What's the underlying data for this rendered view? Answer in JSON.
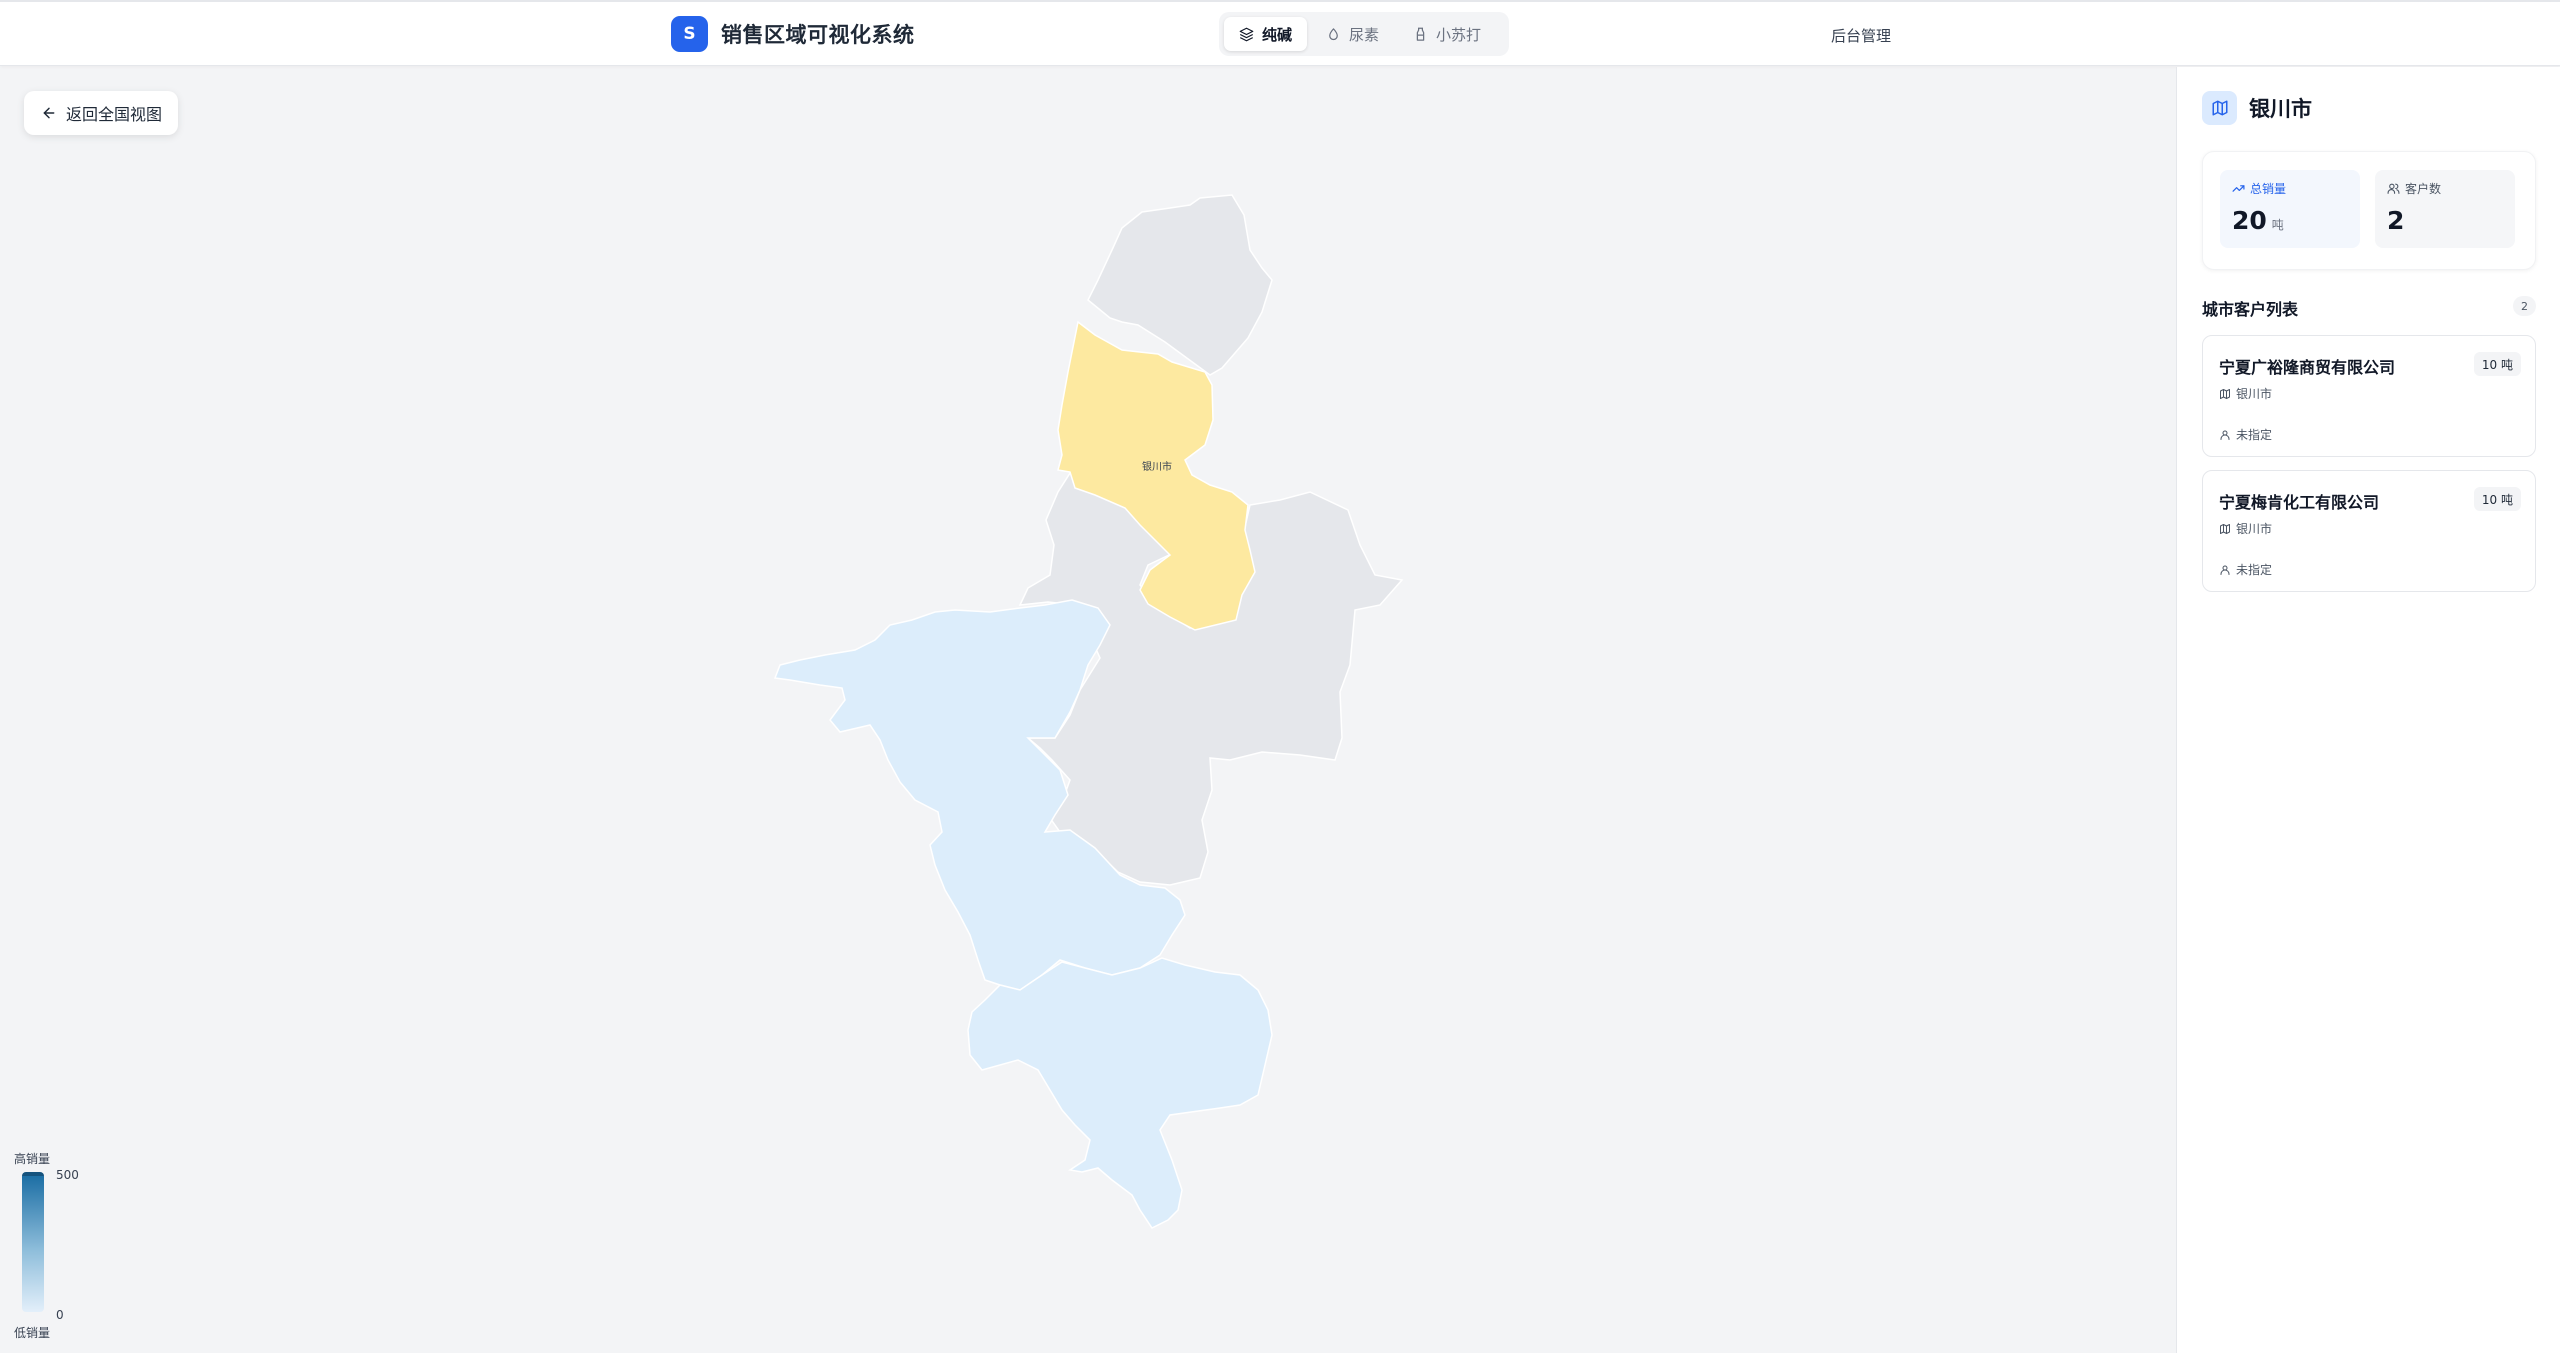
{
  "header": {
    "logo_letter": "S",
    "title": "销售区域可视化系统",
    "tabs": [
      {
        "label": "纯碱",
        "icon": "layers-icon",
        "active": true
      },
      {
        "label": "尿素",
        "icon": "droplet-icon",
        "active": false
      },
      {
        "label": "小苏打",
        "icon": "milk-icon",
        "active": false
      }
    ],
    "admin_label": "后台管理"
  },
  "map": {
    "back_label": "返回全国视图",
    "selected_city_label": "银川市",
    "region_colors": {
      "selected": "#fde9a0",
      "high": "#dcedfb",
      "none": "#e5e7eb"
    },
    "legend": {
      "high_label": "高销量",
      "low_label": "低销量",
      "max": "500",
      "min": "0"
    }
  },
  "sidebar": {
    "city": "银川市",
    "stats": {
      "sales_label": "总销量",
      "sales_value": "20",
      "sales_unit": "吨",
      "customers_label": "客户数",
      "customers_value": "2"
    },
    "list_title": "城市客户列表",
    "list_count": "2",
    "customers": [
      {
        "name": "宁夏广裕隆商贸有限公司",
        "amount": "10 吨",
        "city": "银川市",
        "owner": "未指定"
      },
      {
        "name": "宁夏梅肯化工有限公司",
        "amount": "10 吨",
        "city": "银川市",
        "owner": "未指定"
      }
    ]
  }
}
